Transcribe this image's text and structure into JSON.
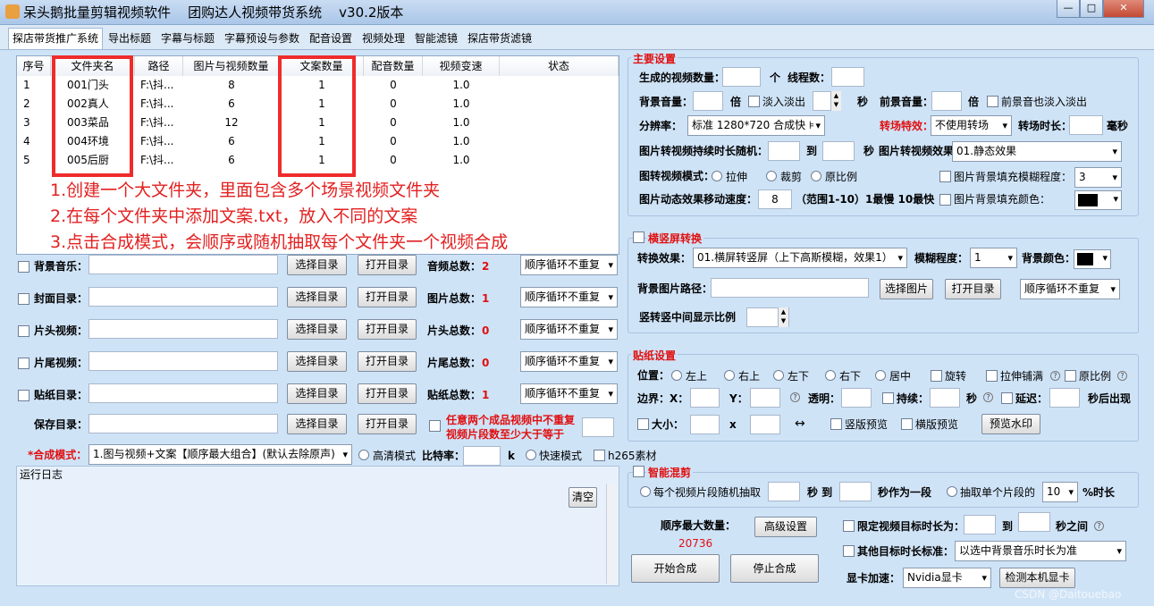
{
  "window": {
    "title": "呆头鹅批量剪辑视频软件    团购达人视频带货系统    v30.2版本",
    "min": "—",
    "max": "□",
    "close": "✕"
  },
  "tabs": [
    "探店带货推广系统",
    "导出标题",
    "字幕与标题",
    "字幕预设与参数",
    "配音设置",
    "视频处理",
    "智能滤镜",
    "探店带货滤镜"
  ],
  "grid": {
    "headers": [
      "序号",
      "文件夹名",
      "路径",
      "图片与视频数量",
      "文案数量",
      "配音数量",
      "视频变速",
      "状态"
    ],
    "rows": [
      [
        "1",
        "001门头",
        "F:\\抖...",
        "8",
        "1",
        "0",
        "1.0",
        ""
      ],
      [
        "2",
        "002真人",
        "F:\\抖...",
        "6",
        "1",
        "0",
        "1.0",
        ""
      ],
      [
        "3",
        "003菜品",
        "F:\\抖...",
        "12",
        "1",
        "0",
        "1.0",
        ""
      ],
      [
        "4",
        "004环境",
        "F:\\抖...",
        "6",
        "1",
        "0",
        "1.0",
        ""
      ],
      [
        "5",
        "005后厨",
        "F:\\抖...",
        "6",
        "1",
        "0",
        "1.0",
        ""
      ]
    ]
  },
  "notes": [
    "1.创建一个大文件夹，里面包含多个场景视频文件夹",
    "2.在每个文件夹中添加文案.txt，放入不同的文案",
    "3.点击合成模式，会顺序或随机抽取每个文件夹一个视频合成"
  ],
  "left": {
    "rows": [
      {
        "label": "背景音乐：",
        "count_label": "音频总数：",
        "count": "2"
      },
      {
        "label": "封面目录：",
        "count_label": "图片总数：",
        "count": "1"
      },
      {
        "label": "片头视频：",
        "count_label": "片头总数：",
        "count": "0"
      },
      {
        "label": "片尾视频：",
        "count_label": "片尾总数：",
        "count": "0"
      },
      {
        "label": "贴纸目录：",
        "count_label": "贴纸总数：",
        "count": "1"
      }
    ],
    "select_dir": "选择目录",
    "open_dir": "打开目录",
    "order_mode": "顺序循环不重复",
    "save_dir": "保存目录：",
    "unique_note_1": "任意两个成品视频中不重复",
    "unique_note_2": "视频片段数至少大于等于",
    "compose_mode_label": "*合成模式：",
    "compose_mode_value": "1.图与视频+文案【顺序最大组合】(默认去除原声)",
    "hd_mode": "高清模式",
    "bitrate": "比特率：",
    "bitrate_unit": "k",
    "fast_mode": "快速模式",
    "h265": "h265素材",
    "log_title": "运行日志",
    "clear": "清空"
  },
  "main_settings": {
    "title": "主要设置",
    "gen_count": "生成的视频数量：",
    "unit_ge": "个",
    "threads": "线程数：",
    "bg_volume": "背景音量：",
    "bei": "倍",
    "fade": "淡入淡出",
    "sec": "秒",
    "fg_volume": "前景音量：",
    "fg_fade": "前景音也淡入淡出",
    "resolution": "分辨率：",
    "resolution_value": "标准 1280*720 合成快 ⊧",
    "transition": "转场特效：",
    "transition_value": "不使用转场",
    "transition_dur": "转场时长：",
    "ms": "毫秒",
    "img_dur": "图片转视频持续时长随机：",
    "to": "到",
    "img_effect": "图片转视频效果：",
    "img_effect_value": "01.静态效果",
    "img_mode": "图转视频模式：",
    "stretch": "拉伸",
    "crop": "裁剪",
    "ratio": "原比例",
    "blur_fill": "图片背景填充模糊程度：",
    "blur_value": "3",
    "move_speed": "图片动态效果移动速度：",
    "move_value": "8",
    "move_range": "（范围1-10）1最慢 10最快",
    "fill_color": "图片背景填充颜色："
  },
  "landscape": {
    "title": "横竖屏转换",
    "effect": "转换效果：",
    "effect_value": "01.横屏转竖屏（上下高斯模糊，效果1）",
    "blur": "模糊程度：",
    "blur_value": "1",
    "bg_color": "背景颜色：",
    "bg_path": "背景图片路径：",
    "select_img": "选择图片",
    "open_dir": "打开目录",
    "order_mode": "顺序循环不重复",
    "mid_ratio": "竖转竖中间显示比例"
  },
  "sticker": {
    "title": "贴纸设置",
    "position": "位置：",
    "pos": [
      "左上",
      "右上",
      "左下",
      "右下",
      "居中"
    ],
    "rotate": "旋转",
    "stretch_tile": "拉伸铺满",
    "ratio": "原比例",
    "margin": "边界：X：",
    "y": "Y：",
    "opacity": "透明：",
    "duration": "持续：",
    "sec": "秒",
    "delay": "延迟：",
    "after_appear": "秒后出现",
    "size": "大小：",
    "x": "x",
    "arrow": "↔",
    "portrait_preview": "竖版预览",
    "landscape_preview": "横版预览",
    "preview_watermark": "预览水印"
  },
  "smart_cut": {
    "title": "智能混剪",
    "each_random": "每个视频片段随机抽取",
    "sec_to": "秒 到",
    "sec_seg": "秒作为一段",
    "single": "抽取单个片段的",
    "single_value": "10",
    "pct": "%时长"
  },
  "bottom": {
    "max_label": "顺序最大数量：",
    "max_value": "20736",
    "advanced": "高级设置",
    "limit_dur": "限定视频目标时长为：",
    "to": "到",
    "between": "秒之间",
    "other_std": "其他目标时长标准：",
    "other_std_value": "以选中背景音乐时长为准",
    "start": "开始合成",
    "stop": "停止合成",
    "gpu_label": "显卡加速：",
    "gpu_value": "Nvidia显卡",
    "detect_gpu": "检测本机显卡",
    "watermark": "CSDN @Daitouebao"
  }
}
